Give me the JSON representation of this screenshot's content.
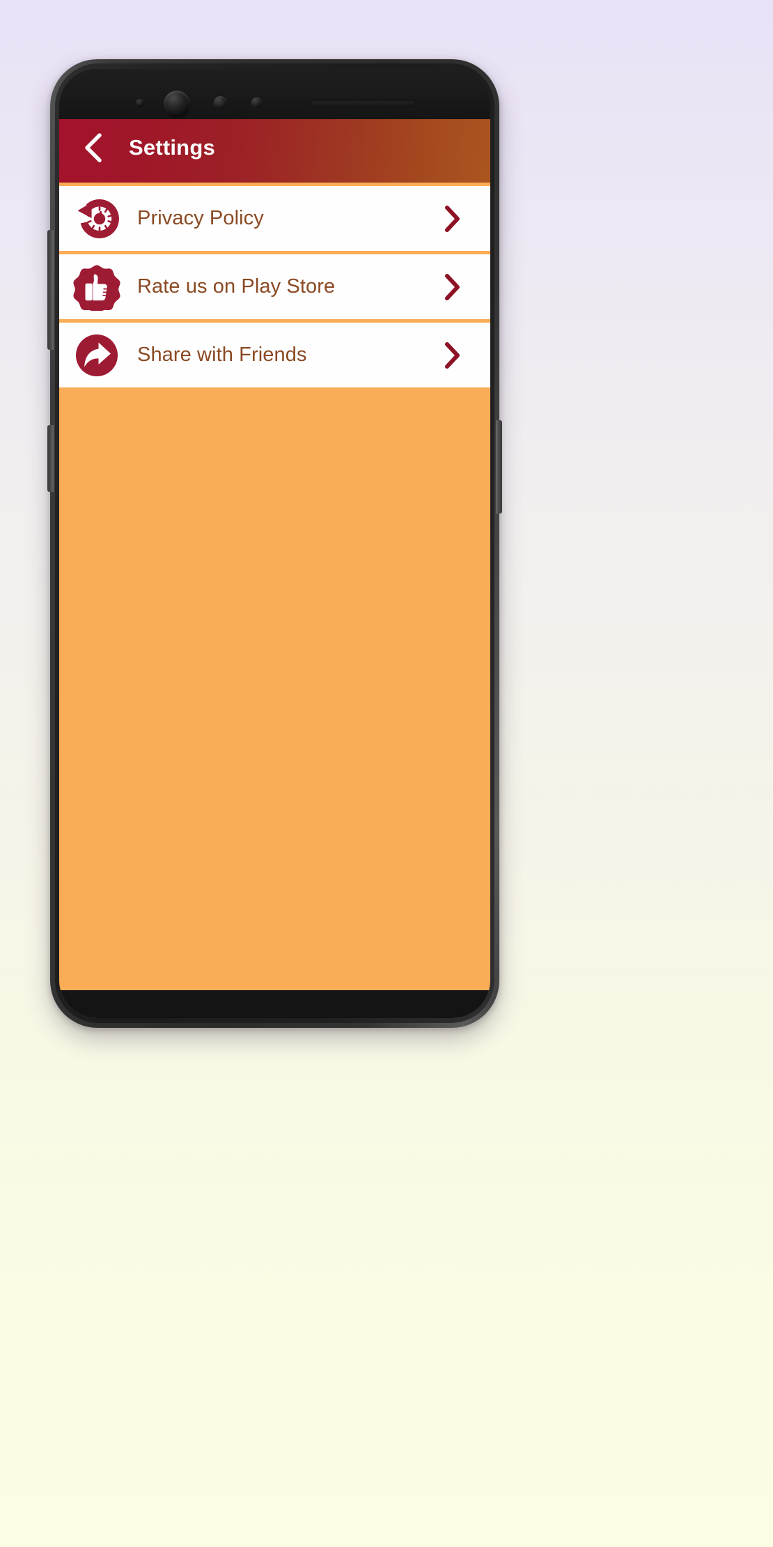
{
  "device": {
    "frame": "samsung-style-phone-mockup",
    "sensors": [
      "sensor-dot",
      "front-camera",
      "proximity-sensor",
      "light-sensor"
    ],
    "earpiece": "speaker-slot",
    "buttons": [
      "volume-rocker",
      "bixby-button",
      "power-button"
    ]
  },
  "appbar": {
    "back_icon": "chevron-left-icon",
    "title": "Settings",
    "gradient_start": "#A4132B",
    "gradient_end": "#AB5520",
    "title_color": "#FFFFFF"
  },
  "screen": {
    "background_color": "#FBAC56",
    "row_background": "#FEFEFE",
    "label_color": "#8A4A23",
    "accent_color": "#9E1B34"
  },
  "settings_list": [
    {
      "id": "privacy-policy",
      "label": "Privacy Policy",
      "icon": "privacy-history-shield-icon",
      "chevron": "chevron-right-icon"
    },
    {
      "id": "rate-us",
      "label": "Rate us on Play Store",
      "icon": "thumbs-up-badge-icon",
      "chevron": "chevron-right-icon"
    },
    {
      "id": "share",
      "label": "Share with Friends",
      "icon": "share-arrow-circle-icon",
      "chevron": "chevron-right-icon"
    }
  ]
}
